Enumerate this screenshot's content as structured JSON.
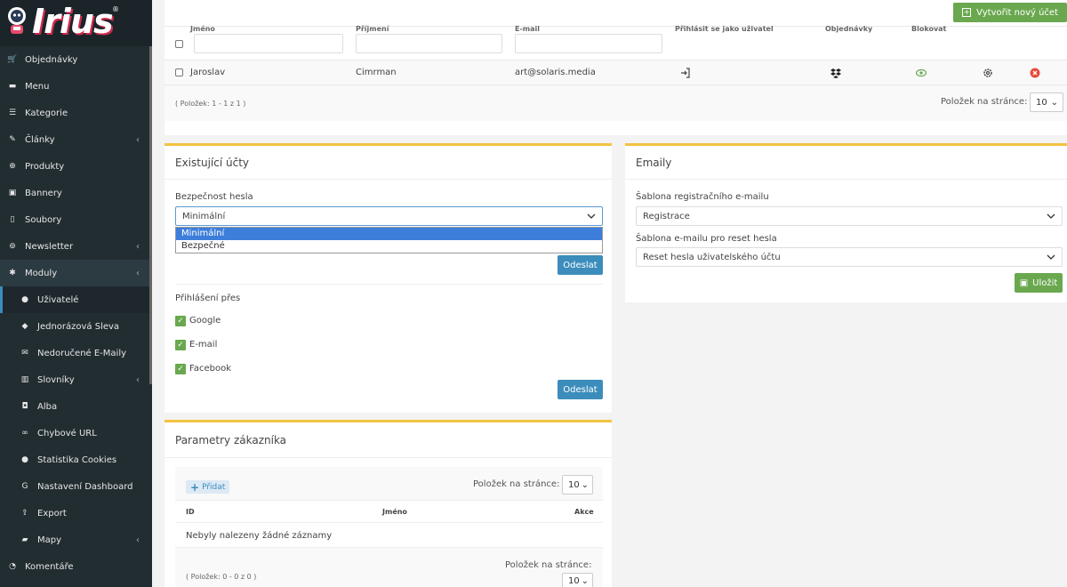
{
  "brand": {
    "name": "Irius",
    "reg": "®"
  },
  "sidebar": {
    "items": [
      {
        "label": "Objednávky",
        "icon": "cart-icon",
        "chev": ""
      },
      {
        "label": "Menu",
        "icon": "folder-icon",
        "chev": ""
      },
      {
        "label": "Kategorie",
        "icon": "list-icon",
        "chev": ""
      },
      {
        "label": "Články",
        "icon": "pencil-icon",
        "chev": "‹"
      },
      {
        "label": "Produkty",
        "icon": "globe-icon",
        "chev": ""
      },
      {
        "label": "Bannery",
        "icon": "image-icon",
        "chev": ""
      },
      {
        "label": "Soubory",
        "icon": "file-icon",
        "chev": ""
      },
      {
        "label": "Newsletter",
        "icon": "newsletter-icon",
        "chev": "‹"
      },
      {
        "label": "Moduly",
        "icon": "puzzle-icon",
        "chev": "‹"
      },
      {
        "label": "Uživatelé",
        "icon": "user-icon",
        "chev": ""
      },
      {
        "label": "Jednorázová Sleva",
        "icon": "tag-icon",
        "chev": ""
      },
      {
        "label": "Nedoručené E-Maily",
        "icon": "mail-icon",
        "chev": ""
      },
      {
        "label": "Slovníky",
        "icon": "book-icon",
        "chev": "‹"
      },
      {
        "label": "Alba",
        "icon": "camera-icon",
        "chev": ""
      },
      {
        "label": "Chybové URL",
        "icon": "link-icon",
        "chev": ""
      },
      {
        "label": "Statistika Cookies",
        "icon": "cookie-icon",
        "chev": ""
      },
      {
        "label": "Nastavení Dashboard",
        "icon": "google-icon",
        "chev": ""
      },
      {
        "label": "Export",
        "icon": "export-icon",
        "chev": ""
      },
      {
        "label": "Mapy",
        "icon": "map-icon",
        "chev": "‹"
      },
      {
        "label": "Komentáře",
        "icon": "comment-icon",
        "chev": ""
      }
    ]
  },
  "toolbar": {
    "create_label": "Vytvořit nový účet"
  },
  "users_table": {
    "headers": [
      "Jméno",
      "Příjmení",
      "E-mail",
      "Přihlásit se jako uživatel",
      "Objednávky",
      "Blokovat"
    ],
    "row": {
      "first": "Jaroslav",
      "last": "Cimrman",
      "email": "art@solaris.media"
    },
    "count_text": "( Položek: 1 - 1 z 1 )",
    "per_page_label": "Položek na stránce:",
    "per_page_value": "10"
  },
  "existing_accounts": {
    "title": "Existující účty",
    "password_label": "Bezpečnost hesla",
    "password_value": "Minimální",
    "password_options": [
      "Minimální",
      "Bezpečné"
    ],
    "send_label": "Odeslat",
    "login_via_label": "Přihlášení přes",
    "login_options": [
      "Google",
      "E-mail",
      "Facebook"
    ],
    "send2_label": "Odeslat"
  },
  "emails": {
    "title": "Emaily",
    "reg_label": "Šablona registračního e-mailu",
    "reg_value": "Registrace",
    "reset_label": "Šablona e-mailu pro reset hesla",
    "reset_value": "Reset hesla uživatelského účtu",
    "save_label": "Uložit"
  },
  "customer_params": {
    "title": "Parametry zákazníka",
    "add_label": "Přidat",
    "per_page_label": "Položek na stránce:",
    "per_page_value": "10",
    "headers": [
      "ID",
      "Jméno",
      "Akce"
    ],
    "empty_text": "Nebyly nalezeny žádné záznamy",
    "count_text": "( Položek: 0 - 0 z 0 )",
    "per_page_label2": "Položek na stránce:",
    "per_page_value2": "10"
  }
}
